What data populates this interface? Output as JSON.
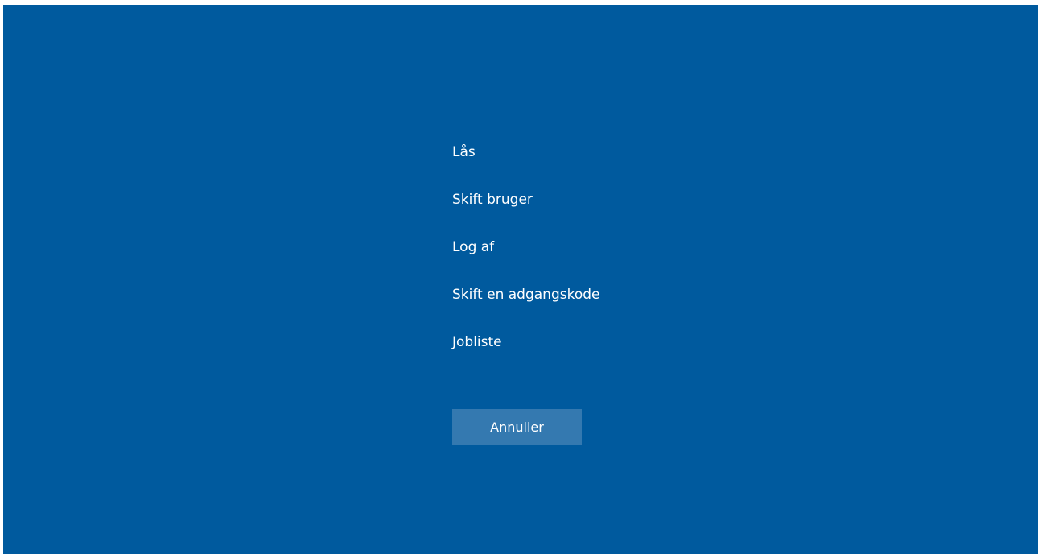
{
  "theme": {
    "background": "#005a9e",
    "button_background": "#3479b0",
    "text_color": "#ffffff"
  },
  "menu": {
    "items": [
      {
        "label": "Lås"
      },
      {
        "label": "Skift bruger"
      },
      {
        "label": "Log af"
      },
      {
        "label": "Skift en adgangskode"
      },
      {
        "label": "Jobliste"
      }
    ]
  },
  "cancel": {
    "label": "Annuller"
  }
}
